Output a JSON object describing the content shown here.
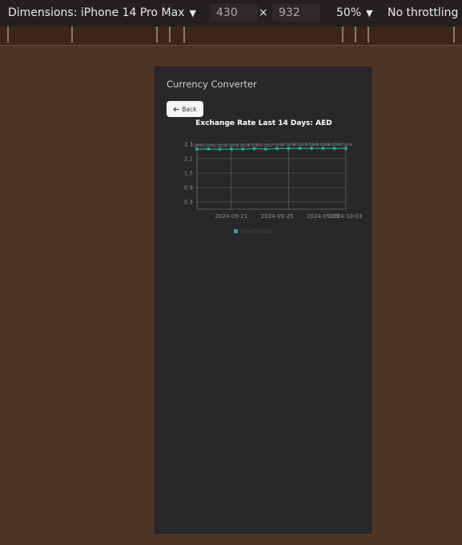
{
  "devtools": {
    "dimensions_label": "Dimensions: iPhone 14 Pro Max",
    "width_value": "430",
    "height_value": "932",
    "times_glyph": "×",
    "zoom_label": "50%",
    "throttling_label": "No throttling",
    "caret_glyph": "▼"
  },
  "app": {
    "title": "Currency Converter",
    "back_label": "Back",
    "back_icon": "arrow-left-icon",
    "chart_title": "Exchange Rate Last 14 Days: AED"
  },
  "colors": {
    "series": "#2aa789",
    "grid": "#6a6a6e",
    "axis_text": "#8e8e92",
    "background": "#28282a"
  },
  "chart_data": {
    "type": "line",
    "title": "Exchange Rate Last 14 Days: AED",
    "x_tick_labels": [
      "2024-09-21",
      "2024-09-25",
      "2024-09-29",
      "2024-10-03"
    ],
    "y_tick_labels": [
      "0.3",
      "0.9",
      "1.5",
      "2.1",
      "2.7"
    ],
    "ylim": [
      0,
      2.7
    ],
    "values": [
      2.5,
      2.5,
      2.49,
      2.5,
      2.5,
      2.52,
      2.5,
      2.52,
      2.53,
      2.53,
      2.53,
      2.53,
      2.53,
      2.53
    ],
    "data_labels": [
      "2.5005",
      "2.498",
      "2.4914",
      "2.5015",
      "2.5022",
      "2.5182",
      "2.501",
      "2.5239",
      "2.5338",
      "2.5327",
      "2.5286",
      "2.5298",
      "2.5291",
      "2.5318"
    ],
    "legend": [
      "rateOnDate"
    ],
    "legend_position": "bottom-center",
    "grid": true
  }
}
